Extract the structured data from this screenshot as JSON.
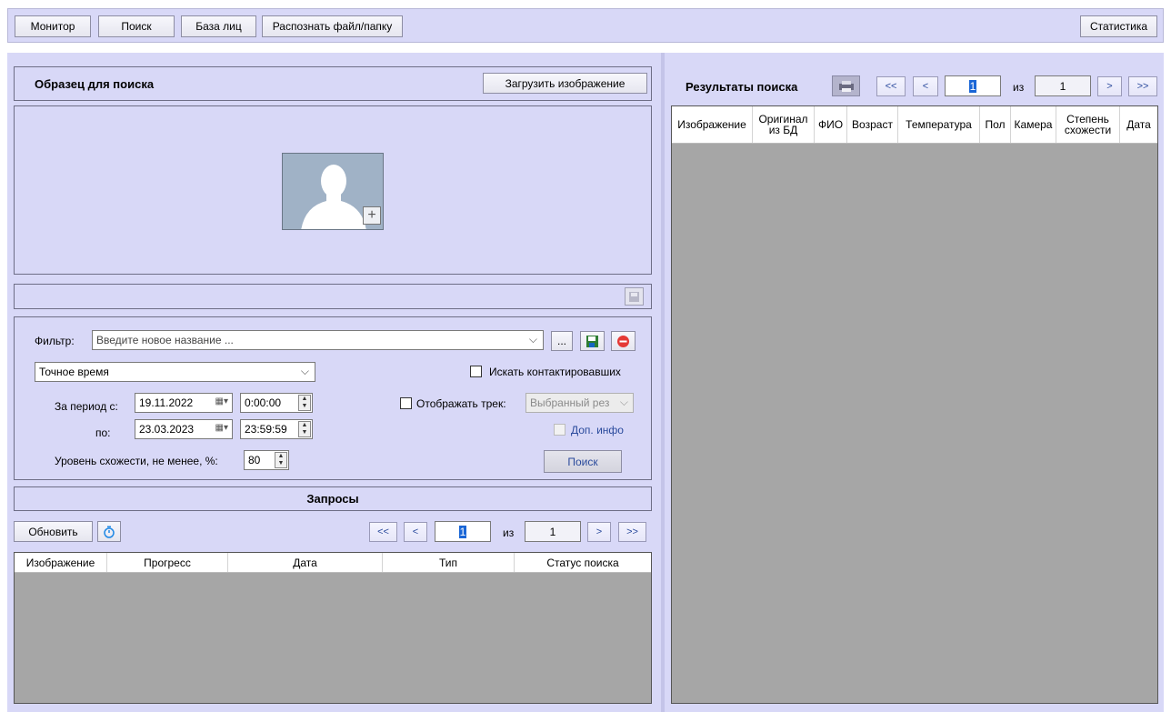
{
  "toolbar": {
    "monitor": "Монитор",
    "search": "Поиск",
    "face_db": "База лиц",
    "recognize": "Распознать файл/папку",
    "statistics": "Статистика"
  },
  "sample": {
    "title": "Образец для поиска",
    "load_button": "Загрузить изображение"
  },
  "filter": {
    "label": "Фильтр:",
    "placeholder": "Введите новое название ...",
    "more_button": "...",
    "time_mode": "Точное время",
    "contacts_label": "Искать контактировавших",
    "period_from_label": "За период с:",
    "period_to_label": "по:",
    "date_from": "19.11.2022",
    "time_from": "0:00:00",
    "date_to": "23.03.2023",
    "time_to": "23:59:59",
    "track_label": "Отображать трек:",
    "track_value": "Выбранный рез",
    "extra_info": "Доп. инфо",
    "similarity_label": "Уровень схожести, не менее, %:",
    "similarity_value": "80",
    "search_button": "Поиск"
  },
  "requests": {
    "title": "Запросы",
    "refresh_button": "Обновить",
    "pager": {
      "first": "<<",
      "prev": "<",
      "current": "1",
      "of": "из",
      "total": "1",
      "next": ">",
      "last": ">>"
    },
    "columns": [
      "Изображение",
      "Прогресс",
      "Дата",
      "Тип",
      "Статус поиска"
    ]
  },
  "results": {
    "title": "Результаты поиска",
    "pager": {
      "first": "<<",
      "prev": "<",
      "current": "1",
      "of": "из",
      "total": "1",
      "next": ">",
      "last": ">>"
    },
    "columns": [
      "Изображение",
      "Оригинал из БД",
      "ФИО",
      "Возраст",
      "Температура",
      "Пол",
      "Камера",
      "Степень схожести",
      "Дата"
    ]
  },
  "icons": [
    "plus-icon",
    "save-icon",
    "delete-icon",
    "calendar-icon",
    "timer-icon",
    "print-icon",
    "avatar-placeholder-icon"
  ],
  "colors": {
    "panel": "#d8d8f7",
    "table_empty": "#a6a6a6",
    "accent": "#2a4a9c"
  }
}
